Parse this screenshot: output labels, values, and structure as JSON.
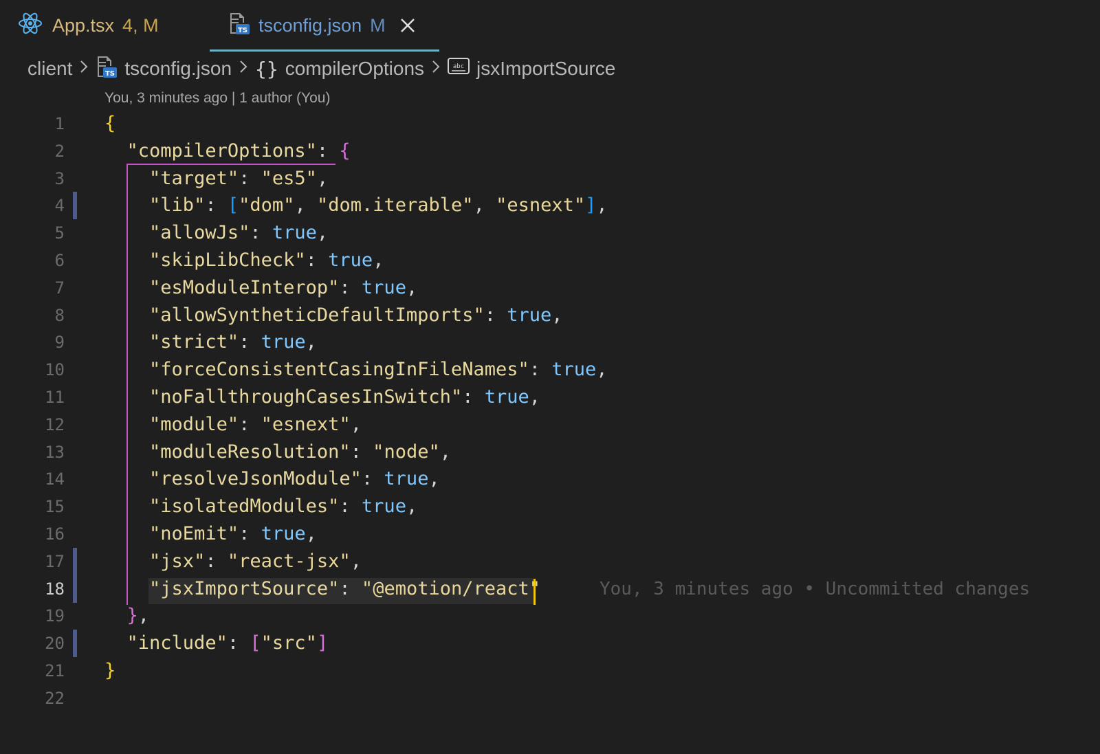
{
  "tabs": [
    {
      "title": "App.tsx",
      "badge": "4, M",
      "icon": "react-icon"
    },
    {
      "title": "tsconfig.json",
      "badge": "M",
      "icon": "ts-file-icon",
      "active": true
    }
  ],
  "breadcrumb": {
    "items": [
      "client",
      "tsconfig.json",
      "compilerOptions",
      "jsxImportSource"
    ]
  },
  "blame_header": "You, 3 minutes ago | 1 author (You)",
  "blame_inline": "You, 3 minutes ago • Uncommitted changes",
  "line_numbers": [
    "1",
    "2",
    "3",
    "4",
    "5",
    "6",
    "7",
    "8",
    "9",
    "10",
    "11",
    "12",
    "13",
    "14",
    "15",
    "16",
    "17",
    "18",
    "19",
    "20",
    "21",
    "22"
  ],
  "active_line": "18",
  "modified_lines": [
    "4",
    "17",
    "18",
    "20"
  ],
  "code": {
    "l2_key": "compilerOptions",
    "l3_key": "target",
    "l3_val": "es5",
    "l4_key": "lib",
    "l4_v1": "dom",
    "l4_v2": "dom.iterable",
    "l4_v3": "esnext",
    "l5_key": "allowJs",
    "l5_val": "true",
    "l6_key": "skipLibCheck",
    "l6_val": "true",
    "l7_key": "esModuleInterop",
    "l7_val": "true",
    "l8_key": "allowSyntheticDefaultImports",
    "l8_val": "true",
    "l9_key": "strict",
    "l9_val": "true",
    "l10_key": "forceConsistentCasingInFileNames",
    "l10_val": "true",
    "l11_key": "noFallthroughCasesInSwitch",
    "l11_val": "true",
    "l12_key": "module",
    "l12_val": "esnext",
    "l13_key": "moduleResolution",
    "l13_val": "node",
    "l14_key": "resolveJsonModule",
    "l14_val": "true",
    "l15_key": "isolatedModules",
    "l15_val": "true",
    "l16_key": "noEmit",
    "l16_val": "true",
    "l17_key": "jsx",
    "l17_val": "react-jsx",
    "l18_key": "jsxImportSource",
    "l18_val": "@emotion/react",
    "l20_key": "include",
    "l20_v1": "src"
  },
  "colors": {
    "background": "#1f1f1f",
    "active_tab_line": "#6fb1c1",
    "json_key": "#e8d9a0",
    "boolean": "#7fc8ff",
    "brace_level1": "#f7d12a",
    "brace_level2": "#d771d8",
    "bracket": "#179fff",
    "cursor": "#f1c40f"
  }
}
